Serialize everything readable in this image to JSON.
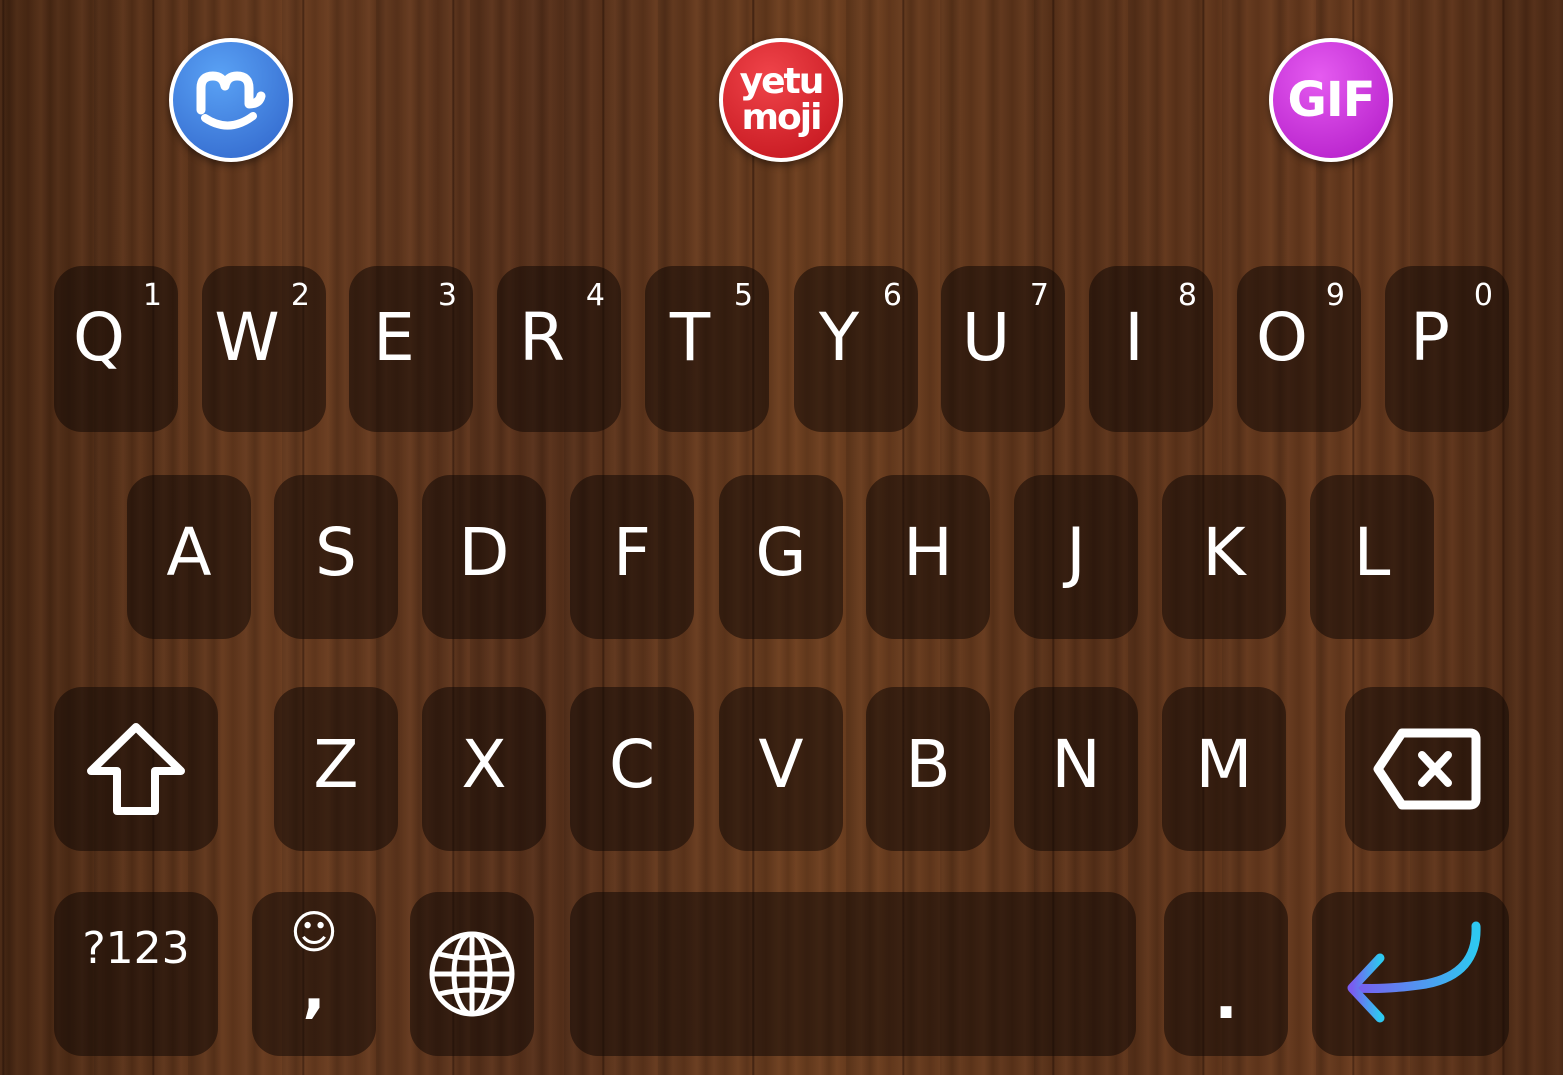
{
  "toolbar": {
    "left_button": {
      "icon": "mojipop-m-icon",
      "color": "#3a7bd5"
    },
    "center_button": {
      "label_line1": "yetu",
      "label_line2": "moji",
      "color": "#d01a22"
    },
    "right_button": {
      "label": "GIF",
      "color": "#c02ad3"
    }
  },
  "keyboard": {
    "row1": [
      {
        "label": "Q",
        "hint": "1"
      },
      {
        "label": "W",
        "hint": "2"
      },
      {
        "label": "E",
        "hint": "3"
      },
      {
        "label": "R",
        "hint": "4"
      },
      {
        "label": "T",
        "hint": "5"
      },
      {
        "label": "Y",
        "hint": "6"
      },
      {
        "label": "U",
        "hint": "7"
      },
      {
        "label": "I",
        "hint": "8"
      },
      {
        "label": "O",
        "hint": "9"
      },
      {
        "label": "P",
        "hint": "0"
      }
    ],
    "row2": [
      "A",
      "S",
      "D",
      "F",
      "G",
      "H",
      "J",
      "K",
      "L"
    ],
    "row3": [
      "Z",
      "X",
      "C",
      "V",
      "B",
      "N",
      "M"
    ],
    "bottom": {
      "symbols_label": "?123",
      "emoji_glyph": "☺",
      "comma_label": ",",
      "period_label": ".",
      "globe_icon": "globe-icon",
      "enter_icon": "enter-arrow-icon"
    },
    "colors": {
      "key_text": "#ffffff",
      "enter_gradient_start": "#7a5cf0",
      "enter_gradient_end": "#2ec8f0"
    }
  }
}
